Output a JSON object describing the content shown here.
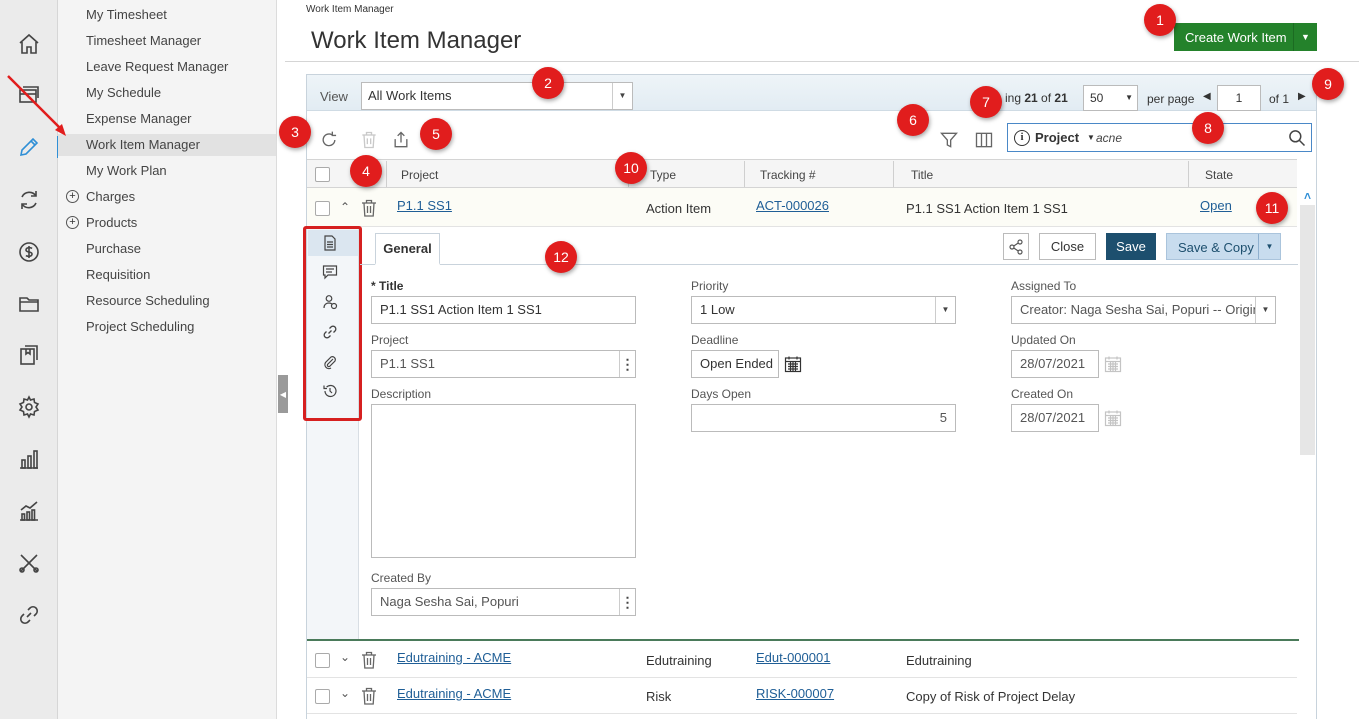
{
  "rail": {
    "icons": [
      "home-icon",
      "card-icon",
      "pencil-icon",
      "sync-icon",
      "dollar-icon",
      "folder-icon",
      "book-icon",
      "gear-icon",
      "bar-chart-icon",
      "trend-chart-icon",
      "tools-icon",
      "link-icon"
    ],
    "active_color": "#2f8fd6"
  },
  "menu": {
    "items": [
      {
        "label": "My Timesheet"
      },
      {
        "label": "Timesheet Manager"
      },
      {
        "label": "Leave Request Manager"
      },
      {
        "label": "My Schedule"
      },
      {
        "label": "Expense Manager"
      },
      {
        "label": "Work Item Manager",
        "active": true
      },
      {
        "label": "My Work Plan"
      },
      {
        "label": "Charges",
        "expandable": true
      },
      {
        "label": "Products",
        "expandable": true
      },
      {
        "label": "Purchase"
      },
      {
        "label": "Requisition"
      },
      {
        "label": "Resource Scheduling"
      },
      {
        "label": "Project Scheduling"
      }
    ]
  },
  "header": {
    "breadcrumb": "Work Item Manager",
    "title": "Work Item Manager",
    "create_label": "Create Work Item",
    "create_color": "#24822b"
  },
  "viewbar": {
    "view_label": "View",
    "view_value": "All Work Items",
    "paging_text_a": "ing ",
    "paging_shown": "21",
    "paging_of": " of ",
    "paging_total": "21",
    "per_page_value": "50",
    "per_page_label": "per page",
    "page_number": "1",
    "page_of": "of 1"
  },
  "search": {
    "field": "Project",
    "query": "acne"
  },
  "table": {
    "columns": [
      "Project",
      "Type",
      "Tracking #",
      "Title",
      "State"
    ],
    "rows": [
      {
        "project": "P1.1 SS1",
        "type": "Action Item",
        "tracking": "ACT-000026",
        "title": "P1.1 SS1 Action Item 1 SS1",
        "state": "Open",
        "expanded": true
      },
      {
        "project": "Edutraining - ACME",
        "type": "Edutraining",
        "tracking": "Edut-000001",
        "title": "Edutraining",
        "state": ""
      },
      {
        "project": "Edutraining - ACME",
        "type": "Risk",
        "tracking": "RISK-000007",
        "title": "Copy of Risk of Project Delay",
        "state": ""
      }
    ]
  },
  "detail": {
    "tab_general": "General",
    "close_label": "Close",
    "save_label": "Save",
    "save_copy_label": "Save & Copy",
    "fields": {
      "title_label": "Title",
      "title_value": "P1.1 SS1 Action Item 1 SS1",
      "project_label": "Project",
      "project_value": "P1.1 SS1",
      "description_label": "Description",
      "created_by_label": "Created By",
      "created_by_value": "Naga Sesha Sai, Popuri",
      "priority_label": "Priority",
      "priority_value": "1 Low",
      "deadline_label": "Deadline",
      "deadline_value": "Open Ended",
      "days_open_label": "Days Open",
      "days_open_value": "5",
      "assigned_label": "Assigned To",
      "assigned_value": "Creator: Naga Sesha Sai, Popuri -- Origin...",
      "updated_label": "Updated On",
      "updated_value": "28/07/2021",
      "created_on_label": "Created On",
      "created_on_value": "28/07/2021"
    }
  },
  "badges": [
    "1",
    "2",
    "3",
    "4",
    "5",
    "6",
    "7",
    "8",
    "9",
    "10",
    "11",
    "12"
  ],
  "annotation_color": "#e11d1d"
}
